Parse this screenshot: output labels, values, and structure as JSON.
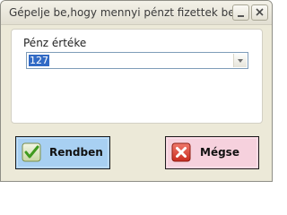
{
  "window": {
    "title": "Gépelje be,hogy mennyi pénzt fizettek be"
  },
  "form": {
    "label": "Pénz értéke",
    "selected_value": "127"
  },
  "buttons": {
    "ok_label": "Rendben",
    "cancel_label": "Mégse"
  },
  "icons": {
    "ok": "checkmark-icon",
    "cancel": "x-icon",
    "minimize": "minimize-icon",
    "close": "close-icon",
    "dropdown": "chevron-down-icon"
  },
  "colors": {
    "ok_button_bg": "#a8d0f2",
    "cancel_button_bg": "#f6d1dd",
    "selection_bg": "#316ac5"
  }
}
